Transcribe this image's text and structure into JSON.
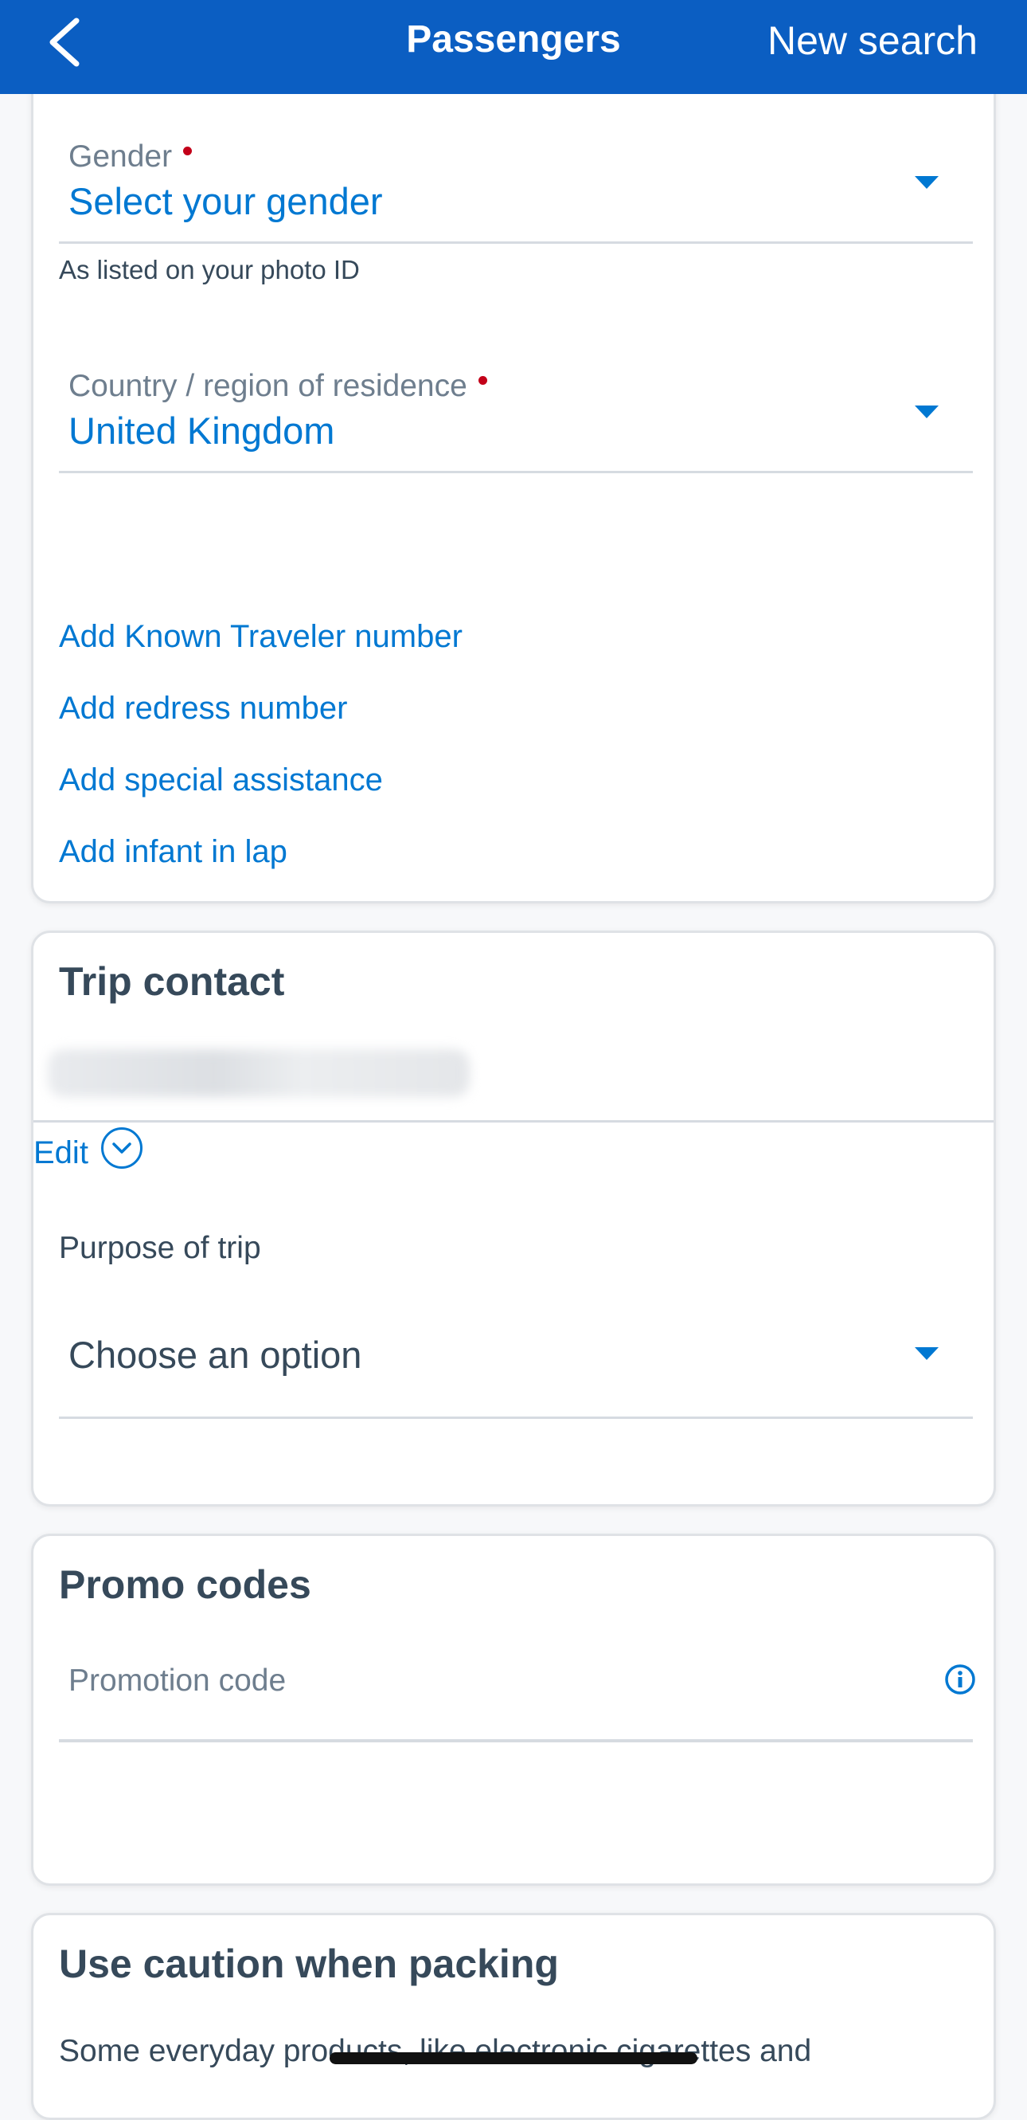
{
  "header": {
    "title": "Passengers",
    "new_search": "New search",
    "back_icon": "chevron-left-icon",
    "bg_color": "#0b5ec2"
  },
  "passenger_card": {
    "gender": {
      "label": "Gender",
      "value": "Select your gender",
      "hint": "As listed on your photo ID"
    },
    "country": {
      "label": "Country / region of residence",
      "value": "United Kingdom"
    },
    "links": [
      "Add Known Traveler number",
      "Add redress number",
      "Add special assistance",
      "Add infant in lap"
    ]
  },
  "trip_contact": {
    "title": "Trip contact",
    "edit_label": "Edit",
    "purpose_label": "Purpose of trip",
    "purpose_value": "Choose an option"
  },
  "promo": {
    "title": "Promo codes",
    "placeholder": "Promotion code"
  },
  "caution": {
    "title": "Use caution when packing",
    "text": "Some everyday products, like electronic cigarettes and"
  },
  "colors": {
    "accent": "#0078d2",
    "required": "#c30019",
    "text": "#36495a"
  }
}
